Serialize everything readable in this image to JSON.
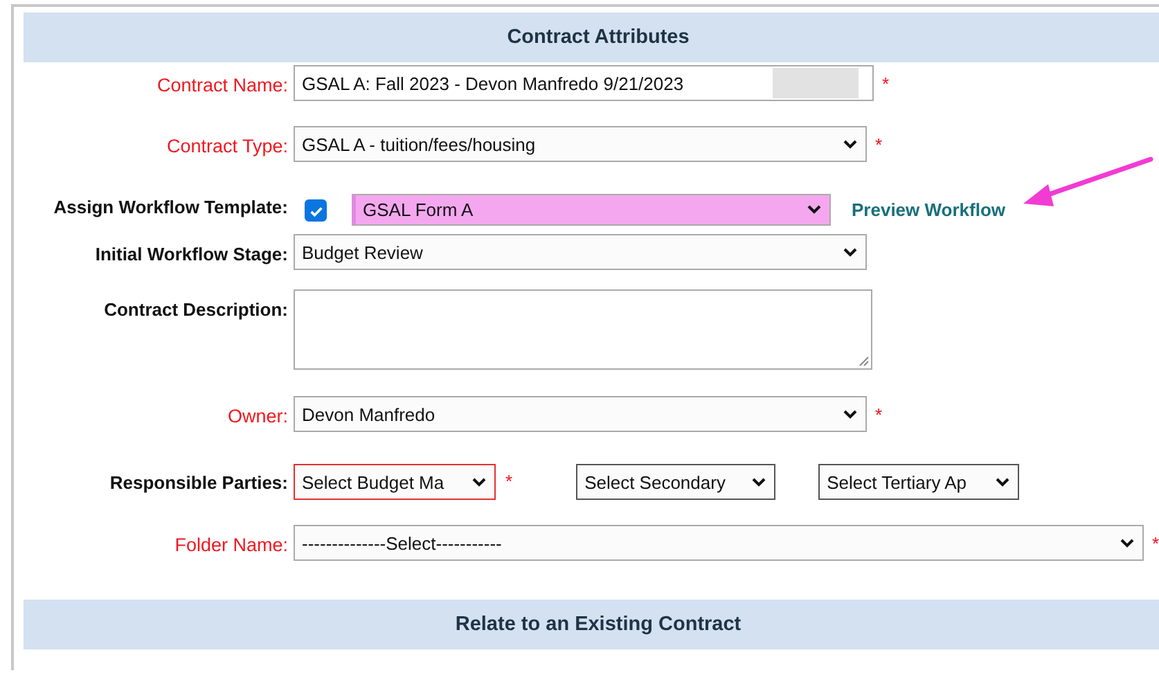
{
  "section_header": "Contract Attributes",
  "fields": [
    {
      "kind": "text",
      "label": "Contract Name:",
      "required": true,
      "value": "GSAL A: Fall 2023 - Devon Manfredo 9/21/2023",
      "asterisk": "*"
    },
    {
      "kind": "select",
      "label": "Contract Type:",
      "required": true,
      "value": "GSAL A - tuition/fees/housing",
      "asterisk": "*"
    },
    {
      "kind": "checkbox_select",
      "label": "Assign Workflow Template:",
      "required": false,
      "checked": true,
      "value": "GSAL Form A",
      "highlighted": true,
      "link": "Preview Workflow"
    },
    {
      "kind": "select",
      "label": "Initial Workflow Stage:",
      "required": false,
      "value": "Budget Review"
    },
    {
      "kind": "textarea",
      "label": "Contract Description:",
      "required": false
    },
    {
      "kind": "select",
      "label": "Owner:",
      "required": true,
      "value": "Devon Manfredo",
      "asterisk": "*"
    },
    {
      "kind": "multi_select",
      "label": "Responsible Parties:",
      "required": false,
      "selects": [
        {
          "value": "Select Budget Ma",
          "invalid": true,
          "asterisk": "*"
        },
        {
          "value": "Select Secondary",
          "invalid": false
        },
        {
          "value": "Select Tertiary Ap",
          "invalid": false
        }
      ]
    },
    {
      "kind": "wide_select",
      "label": "Folder Name:",
      "required": true,
      "value": "--------------Select-----------",
      "asterisk": "*"
    }
  ],
  "next_section_header": "Relate to an Existing Contract"
}
